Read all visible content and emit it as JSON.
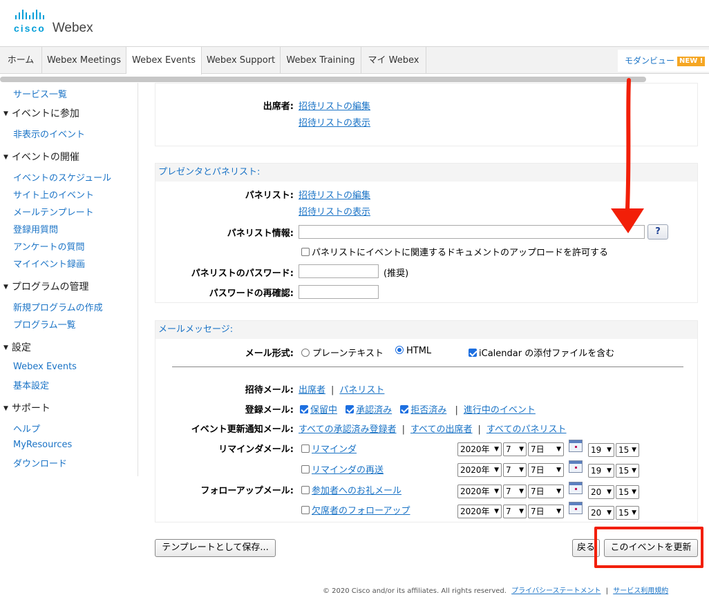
{
  "brand": {
    "company": "cisco",
    "product": "Webex"
  },
  "tabs": [
    {
      "label": "ホーム"
    },
    {
      "label": "Webex Meetings"
    },
    {
      "label": "Webex Events"
    },
    {
      "label": "Webex Support"
    },
    {
      "label": "Webex Training"
    },
    {
      "label": "マイ Webex"
    }
  ],
  "modern_view": {
    "label": "モダンビュー",
    "badge": "NEW !"
  },
  "sidebar": {
    "items": [
      {
        "label": "サービス一覧"
      },
      {
        "label": "イベントに参加"
      },
      {
        "label": "非表示のイベント"
      },
      {
        "label": "イベントの開催"
      },
      {
        "label": "イベントのスケジュール"
      },
      {
        "label": "サイト上のイベント"
      },
      {
        "label": "メールテンプレート"
      },
      {
        "label": "登録用質問"
      },
      {
        "label": "アンケートの質問"
      },
      {
        "label": "マイイベント録画"
      },
      {
        "label": "プログラムの管理"
      },
      {
        "label": "新規プログラムの作成"
      },
      {
        "label": "プログラム一覧"
      },
      {
        "label": "設定"
      },
      {
        "label": "Webex Events"
      },
      {
        "label": "基本設定"
      },
      {
        "label": "サポート"
      },
      {
        "label": "ヘルプ"
      },
      {
        "label": "MyResources"
      },
      {
        "label": "ダウンロード"
      }
    ]
  },
  "attendees": {
    "label": "出席者:",
    "edit_link": "招待リストの編集",
    "view_link": "招待リストの表示"
  },
  "presenters": {
    "title": "プレゼンタとパネリスト:",
    "panelist_label": "パネリスト:",
    "edit_link": "招待リストの編集",
    "view_link": "招待リストの表示",
    "info_label": "パネリスト情報:",
    "info_value": "",
    "help": "?",
    "upload_checkbox": "パネリストにイベントに関連するドキュメントのアップロードを許可する",
    "password_label": "パネリストのパスワード:",
    "password_hint": "(推奨)",
    "confirm_label": "パスワードの再確認:"
  },
  "email": {
    "title": "メールメッセージ:",
    "format_label": "メール形式:",
    "plain_text": "プレーンテキスト",
    "html": "HTML",
    "ical": "iCalendar の添付ファイルを含む",
    "invite_label": "招待メール:",
    "invite_attendees": "出席者",
    "invite_panelists": "パネリスト",
    "registration_label": "登録メール:",
    "pending": "保留中",
    "approved": "承認済み",
    "rejected": "拒否済み",
    "ongoing": "進行中のイベント",
    "update_label": "イベント更新通知メール:",
    "all_approved": "すべての承認済み登録者",
    "all_attendees": "すべての出席者",
    "all_panelists": "すべてのパネリスト",
    "reminder_label": "リマインダメール:",
    "followup_label": "フォローアップメール:",
    "rows": [
      {
        "link": "リマインダ",
        "year": "2020年",
        "month": "7",
        "day": "7日",
        "hour": "19",
        "minute": "15"
      },
      {
        "link": "リマインダの再送",
        "year": "2020年",
        "month": "7",
        "day": "7日",
        "hour": "19",
        "minute": "15"
      },
      {
        "link": "参加者へのお礼メール",
        "year": "2020年",
        "month": "7",
        "day": "7日",
        "hour": "20",
        "minute": "15"
      },
      {
        "link": "欠席者のフォローアップ",
        "year": "2020年",
        "month": "7",
        "day": "7日",
        "hour": "20",
        "minute": "15"
      }
    ]
  },
  "buttons": {
    "save_template": "テンプレートとして保存...",
    "back": "戻る",
    "update": "このイベントを更新"
  },
  "footer": {
    "copyright": "© 2020 Cisco and/or its affiliates. All rights reserved.",
    "privacy": "プライバシーステートメント",
    "terms": "サービス利用規約"
  },
  "colors": {
    "link": "#1a73c6",
    "annotation": "#f21f08",
    "brand": "#049fd9"
  }
}
